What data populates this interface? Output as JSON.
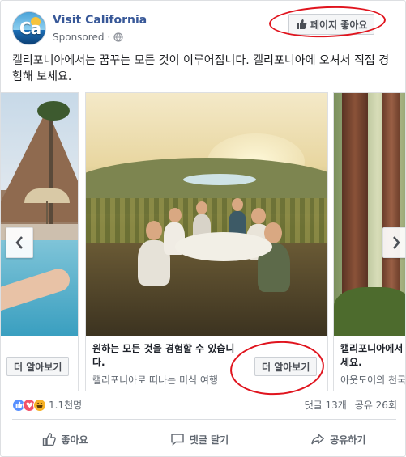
{
  "header": {
    "page_name": "Visit California",
    "sponsored": "Sponsored",
    "separator": "·",
    "like_page_button": "페이지 좋아요",
    "avatar_logo": "Ca"
  },
  "message": "캘리포니아에서는 꿈꾸는 모든 것이 이루어집니다. 캘리포니아에 오셔서 직접 경험해 보세요.",
  "carousel": {
    "left_card": {
      "button": "더 알아보기"
    },
    "main_card": {
      "headline": "원하는 모든 것을 경험할 수 있습니다.",
      "description": "캘리포니아로 떠나는 미식 여행",
      "button": "더 알아보기"
    },
    "right_card": {
      "headline": "캘리포니아에서 보세요.",
      "description": "아웃도어의 천국"
    }
  },
  "reactions": {
    "count": "1.1천명",
    "comments": "댓글 13개",
    "shares": "공유 26회",
    "icons": [
      "like-icon",
      "love-icon",
      "haha-icon"
    ]
  },
  "actions": {
    "like": "좋아요",
    "comment": "댓글 달기",
    "share": "공유하기"
  },
  "colors": {
    "link": "#385898",
    "annotation_red": "#e0141e",
    "like_blue": "#5890ff"
  }
}
